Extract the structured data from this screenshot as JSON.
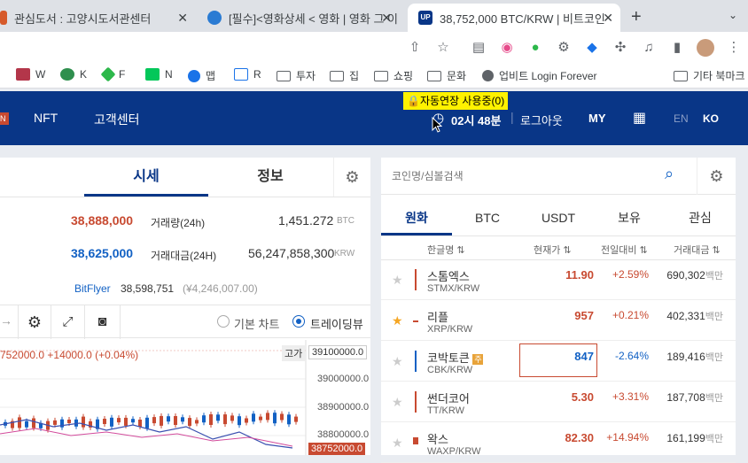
{
  "tabs": [
    {
      "title": "관심도서 : 고양시도서관센터"
    },
    {
      "title": "[필수]<영화상세 < 영화 | 영화 그 이"
    },
    {
      "title": "38,752,000 BTC/KRW | 비트코인"
    }
  ],
  "bookmarks": [
    "W",
    "K",
    "F",
    "N",
    "맵",
    "R",
    "투자",
    "집",
    "쇼핑",
    "문화",
    "업비트 Login Forever",
    "기타 북마크"
  ],
  "header": {
    "nav": [
      "NFT",
      "고객센터"
    ],
    "auto_ext": "🔒자동연장 사용중(0)",
    "timer": "02시 48분",
    "logout": "로그아웃",
    "my": "MY",
    "lang_en": "EN",
    "lang_ko": "KO"
  },
  "left": {
    "tabs": [
      "시세",
      "정보"
    ],
    "high_price": "38,888,000",
    "low_price": "38,625,000",
    "vol_label": "거래량(24h)",
    "vol_value": "1,451.272",
    "vol_unit": "BTC",
    "amt_label": "거래대금(24H)",
    "amt_value": "56,247,858,300",
    "amt_unit": "KRW",
    "bitflyer_label": "BitFlyer",
    "bitflyer_value": "38,598,751",
    "bitflyer_yen": "(¥4,246,007.00)",
    "chart_basic": "기본 차트",
    "chart_trading": "트레이딩뷰",
    "chart_info": "752000.0 +14000.0 (+0.04%)",
    "high_tag": "고가",
    "axis": [
      "39100000.0",
      "39000000.0",
      "38900000.0",
      "38800000.0",
      "38752000.0"
    ]
  },
  "right": {
    "search_placeholder": "코인명/심볼검색",
    "tabs": [
      "원화",
      "BTC",
      "USDT",
      "보유",
      "관심"
    ],
    "headers": [
      "한글명",
      "현재가",
      "전일대비",
      "거래대금"
    ],
    "coins": [
      {
        "name": "스톰엑스",
        "sym": "STMX/KRW",
        "price": "11.90",
        "change": "+2.59%",
        "vol": "690,302",
        "unit": "백만"
      },
      {
        "name": "리플",
        "sym": "XRP/KRW",
        "price": "957",
        "change": "+0.21%",
        "vol": "402,331",
        "unit": "백만"
      },
      {
        "name": "코박토큰",
        "sym": "CBK/KRW",
        "price": "847",
        "change": "-2.64%",
        "vol": "189,416",
        "unit": "백만"
      },
      {
        "name": "썬더코어",
        "sym": "TT/KRW",
        "price": "5.30",
        "change": "+3.31%",
        "vol": "187,708",
        "unit": "백만"
      },
      {
        "name": "왁스",
        "sym": "WAXP/KRW",
        "price": "82.30",
        "change": "+14.94%",
        "vol": "161,199",
        "unit": "백만"
      }
    ]
  },
  "colors": {
    "brand": "#093687",
    "up": "#c84a31",
    "down": "#1261c4"
  }
}
